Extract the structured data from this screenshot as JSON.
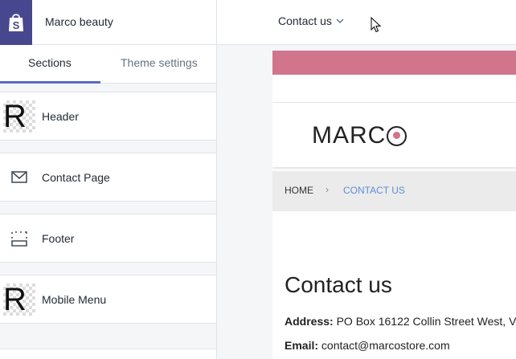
{
  "app": {
    "store_name": "Marco beauty"
  },
  "page_selector": {
    "current": "Contact us"
  },
  "tabs": [
    {
      "label": "Sections"
    },
    {
      "label": "Theme settings"
    }
  ],
  "sections": [
    {
      "label": "Header",
      "thumb_text": "R"
    },
    {
      "label": "Contact Page"
    },
    {
      "label": "Footer"
    },
    {
      "label": "Mobile Menu",
      "thumb_text": "R"
    }
  ],
  "preview": {
    "brand_left": "MARC",
    "breadcrumb": {
      "home": "HOME",
      "separator": "›",
      "current": "CONTACT US"
    },
    "heading": "Contact us",
    "address_label": "Address:",
    "address_value": "PO Box 16122 Collin Street West, V",
    "email_label": "Email:",
    "email_value": "contact@marcostore.com"
  },
  "colors": {
    "accent": "#5c6ac4",
    "brand_pink": "#d0758b",
    "logo_bg": "#47478f",
    "breadcrumb_link": "#5b8ed8"
  }
}
